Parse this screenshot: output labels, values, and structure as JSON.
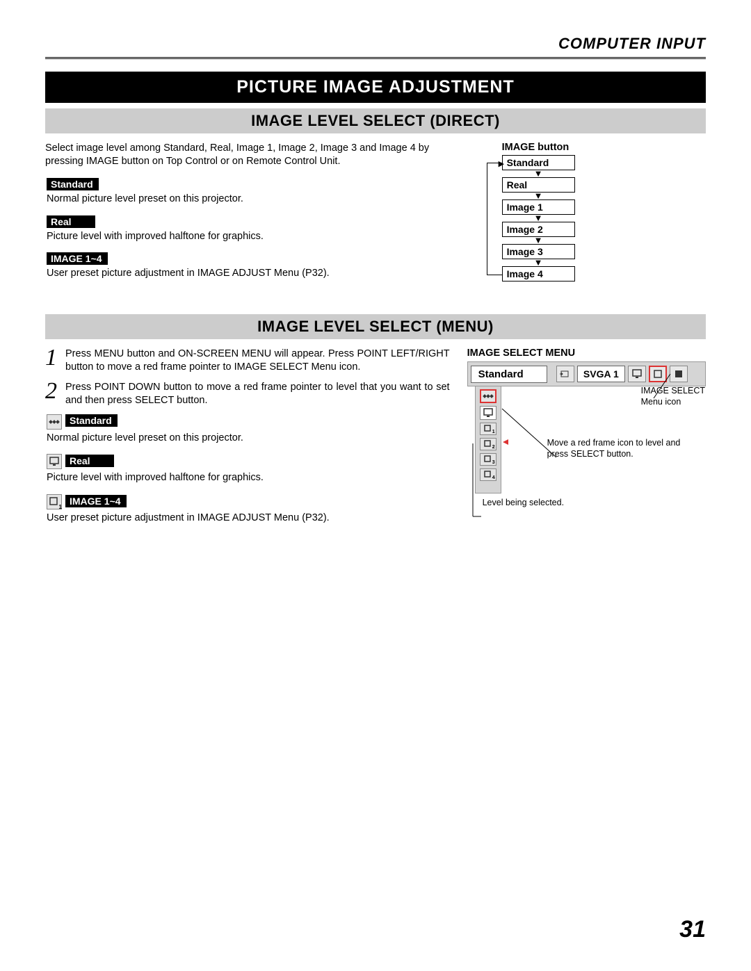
{
  "header": {
    "section": "COMPUTER INPUT"
  },
  "title": "PICTURE IMAGE ADJUSTMENT",
  "subtitle1": "IMAGE LEVEL SELECT (DIRECT)",
  "direct": {
    "intro": "Select image level among Standard, Real, Image 1, Image 2, Image 3 and Image 4 by pressing IMAGE button on Top Control or on Remote Control Unit.",
    "items": [
      {
        "label": "Standard",
        "desc": "Normal picture level preset on this projector."
      },
      {
        "label": "Real",
        "desc": "Picture level with improved halftone for graphics."
      },
      {
        "label": "IMAGE 1~4",
        "desc": "User preset picture adjustment in IMAGE ADJUST Menu (P32)."
      }
    ],
    "flow": {
      "title": "IMAGE button",
      "boxes": [
        "Standard",
        "Real",
        "Image 1",
        "Image 2",
        "Image 3",
        "Image 4"
      ]
    }
  },
  "subtitle2": "IMAGE LEVEL SELECT (MENU)",
  "menu_sec": {
    "steps": [
      {
        "n": "1",
        "text": "Press MENU button and ON-SCREEN MENU will appear.  Press POINT LEFT/RIGHT button to move a red frame pointer to IMAGE SELECT Menu icon."
      },
      {
        "n": "2",
        "text": "Press POINT DOWN button to move a red frame pointer to level that you want to set and then press SELECT button."
      }
    ],
    "items": [
      {
        "label": "Standard",
        "desc": "Normal picture level preset on this projector."
      },
      {
        "label": "Real",
        "desc": "Picture level with improved halftone for graphics."
      },
      {
        "label": "IMAGE 1~4",
        "desc": "User preset picture adjustment in IMAGE ADJUST Menu (P32)."
      }
    ],
    "menu": {
      "title": "IMAGE SELECT MENU",
      "label_box": "Standard",
      "svga": "SVGA 1",
      "annot1a": "IMAGE SELECT",
      "annot1b": "Menu icon",
      "annot2": "Move a red frame icon to level and press SELECT button.",
      "annot3": "Level being selected."
    }
  },
  "page": "31"
}
